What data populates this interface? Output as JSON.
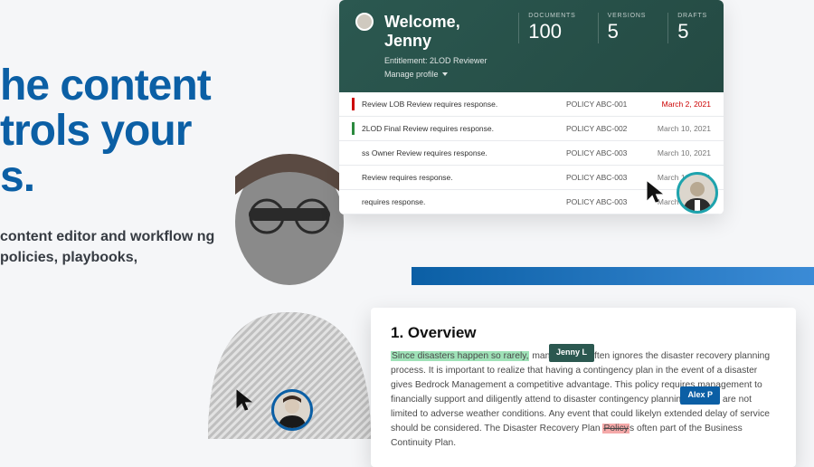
{
  "hero": {
    "line1": "he content",
    "line2": "trols your",
    "line3": "s.",
    "sub": "content editor and workflow ng policies, playbooks,"
  },
  "dashboard": {
    "welcome": "Welcome, Jenny",
    "entitlement": "Entitlement: 2LOD Reviewer",
    "manage": "Manage profile",
    "stats": [
      {
        "label": "DOCUMENTS",
        "value": "100"
      },
      {
        "label": "VERSIONS",
        "value": "5"
      },
      {
        "label": "DRAFTS",
        "value": "5"
      }
    ],
    "rows": [
      {
        "bar": "red",
        "text": "Review LOB Review requires response.",
        "policy": "POLICY ABC-001",
        "date": "March 2, 2021",
        "urgent": true
      },
      {
        "bar": "green",
        "text": "2LOD Final Review requires response.",
        "policy": "POLICY ABC-002",
        "date": "March 10, 2021",
        "urgent": false
      },
      {
        "bar": "",
        "text": "ss Owner Review requires response.",
        "policy": "POLICY ABC-003",
        "date": "March 10, 2021",
        "urgent": false
      },
      {
        "bar": "",
        "text": "Review requires response.",
        "policy": "POLICY ABC-003",
        "date": "March 10, 2021",
        "urgent": false
      },
      {
        "bar": "",
        "text": "requires response.",
        "policy": "POLICY ABC-003",
        "date": "March 10, 2021",
        "urgent": false
      }
    ]
  },
  "doc": {
    "heading": "1.  Overview",
    "tag_jenny": "Jenny L",
    "tag_alex": "Alex P",
    "hl_green": "Since disasters happen so rarely,",
    "body1": " management often ignores the disaster recovery planning process. It is important to realize that having a contingency plan in the event of a disaster gives Bedrock Management a competitive advantage.  This policy requires management to financially support and diligently attend to disaster contingency plannin",
    "body2": "Disasters are not limited to adverse weather conditions. Any event that could likely",
    "body3": "n extended delay of service should be considered. The Disaster Recovery Plan ",
    "hl_red": "Policy",
    "body4": "s often part of the Business Continuity Plan."
  }
}
